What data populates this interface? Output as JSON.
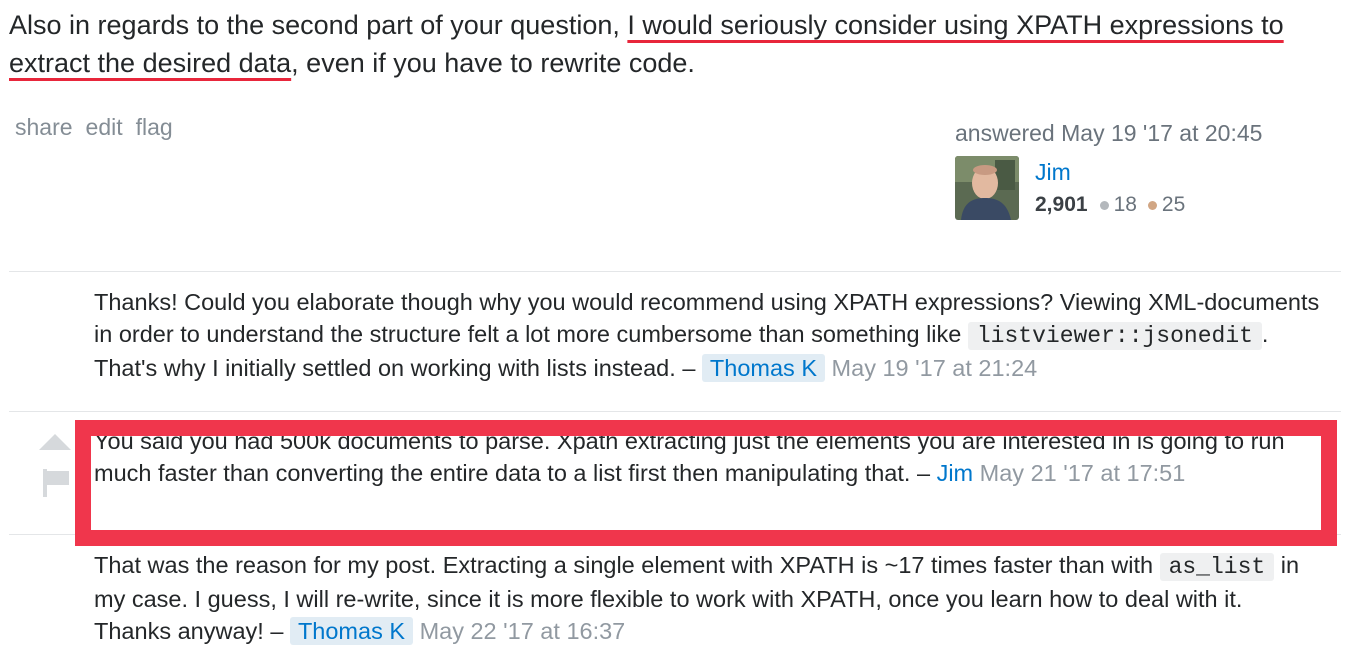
{
  "answer": {
    "text_before": "Also in regards to the second part of your question, ",
    "text_highlight": "I would seriously consider using XPATH expressions to extract the desired data",
    "text_after": ", even if you have to rewrite code."
  },
  "post_menu": {
    "share": "share",
    "edit": "edit",
    "flag": "flag"
  },
  "signature": {
    "action": "answered May 19 '17 at 20:45",
    "user_name": "Jim",
    "reputation": "2,901",
    "silver_badges": "18",
    "bronze_badges": "25",
    "colors": {
      "silver": "#b4b8bc",
      "bronze": "#d1a684"
    }
  },
  "comments": [
    {
      "text_before": "Thanks! Could you elaborate though why you would recommend using XPATH expressions? Viewing XML-documents in order to understand the structure felt a lot more cumbersome than something like ",
      "code": "listviewer::jsonedit",
      "text_after": ". That's why I initially settled on working with lists instead. – ",
      "user": "Thomas K",
      "date": "May 19 '17 at 21:24"
    },
    {
      "text": "You said you had 500k documents to parse. Xpath extracting just the elements you are interested in is going to run much faster than converting the entire data to a list first then manipulating that. – ",
      "user": "Jim",
      "date": "May 21 '17 at 17:51"
    },
    {
      "text_before": "That was the reason for my post. Extracting a single element with XPATH is ~17 times faster than with ",
      "code": "as_list",
      "text_after": " in my case. I guess, I will re-write, since it is more flexible to work with XPATH, once you learn how to deal with it. Thanks anyway! – ",
      "user": "Thomas K",
      "date": "May 22 '17 at 16:37"
    }
  ],
  "colors": {
    "link": "#0077cc",
    "highlight_red": "#f0364c",
    "muted": "#9199a1"
  }
}
